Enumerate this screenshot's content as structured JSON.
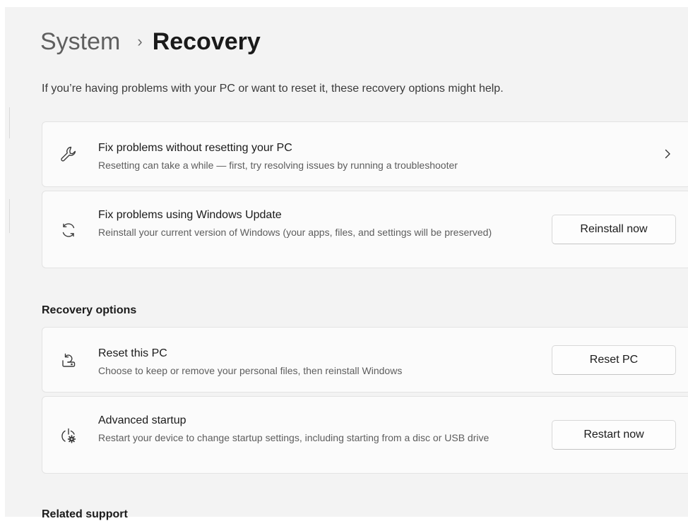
{
  "breadcrumb": {
    "parent": "System",
    "separator": "›",
    "current": "Recovery"
  },
  "intro": "If you’re having problems with your PC or want to reset it, these recovery options might help.",
  "cards": {
    "fix_without_reset": {
      "icon": "wrench-icon",
      "title": "Fix problems without resetting your PC",
      "description": "Resetting can take a while — first, try resolving issues by running a troubleshooter",
      "action_icon": "chevron-right-icon"
    },
    "windows_update": {
      "icon": "sync-icon",
      "title": "Fix problems using Windows Update",
      "description": "Reinstall your current version of Windows (your apps, files, and settings will be preserved)",
      "button": "Reinstall now"
    }
  },
  "recovery_options": {
    "heading": "Recovery options",
    "reset_pc": {
      "icon": "reset-pc-icon",
      "title": "Reset this PC",
      "description": "Choose to keep or remove your personal files, then reinstall Windows",
      "button": "Reset PC"
    },
    "advanced_startup": {
      "icon": "advanced-startup-icon",
      "title": "Advanced startup",
      "description": "Restart your device to change startup settings, including starting from a disc or USB drive",
      "button": "Restart now"
    }
  },
  "related_support": {
    "heading": "Related support"
  },
  "colors": {
    "page_background": "#f3f3f3",
    "card_background": "#fbfbfb",
    "card_border": "#e3e3e3",
    "secondary_text": "#5d5d5d"
  }
}
